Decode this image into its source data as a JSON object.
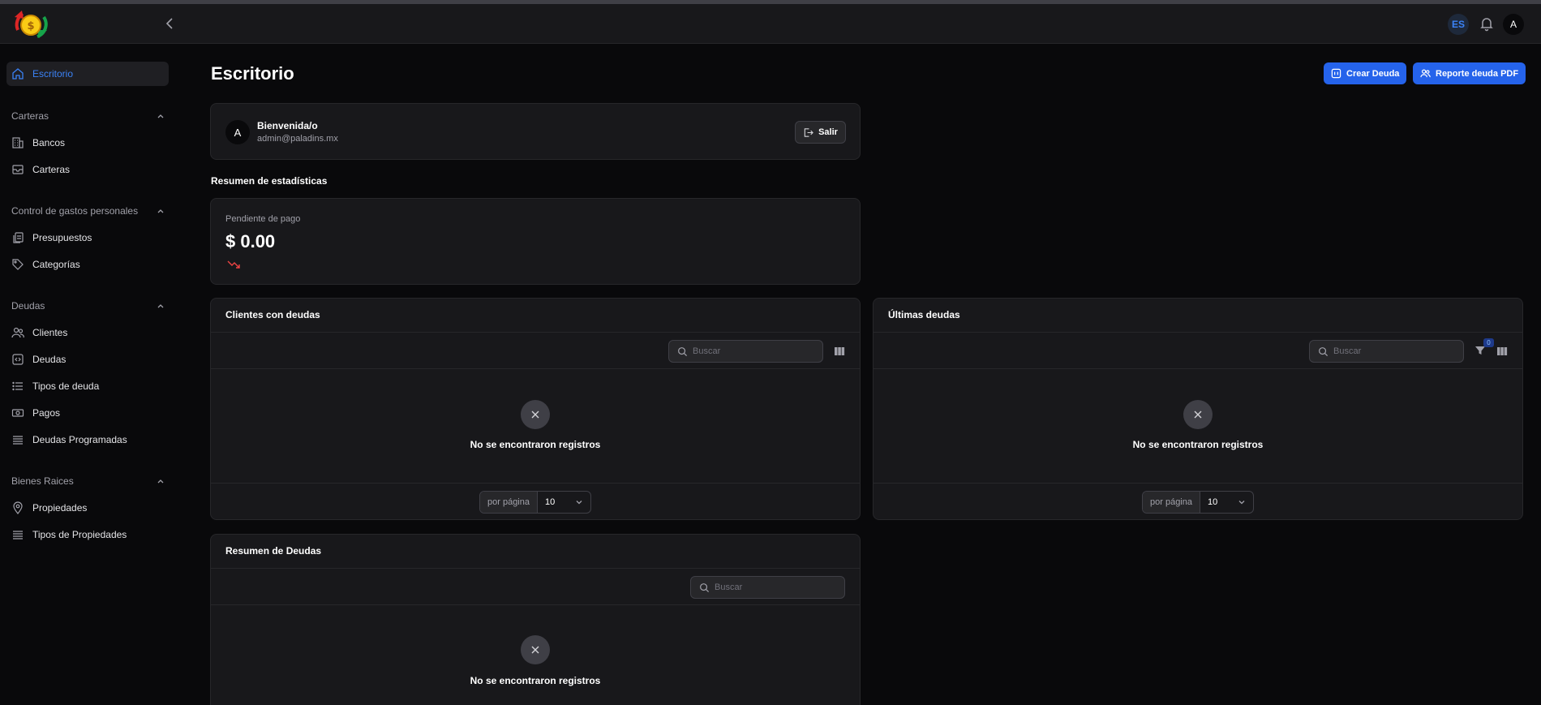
{
  "topbar": {
    "lang_badge": "ES",
    "avatar_initial": "A"
  },
  "sidebar": {
    "active_item": "Escritorio",
    "groups": [
      {
        "label": "Carteras",
        "items": [
          "Bancos",
          "Carteras"
        ]
      },
      {
        "label": "Control de gastos personales",
        "items": [
          "Presupuestos",
          "Categorías"
        ]
      },
      {
        "label": "Deudas",
        "items": [
          "Clientes",
          "Deudas",
          "Tipos de deuda",
          "Pagos",
          "Deudas Programadas"
        ]
      },
      {
        "label": "Bienes Raices",
        "items": [
          "Propiedades",
          "Tipos de Propiedades"
        ]
      }
    ]
  },
  "header": {
    "title": "Escritorio",
    "create_debt_label": "Crear Deuda",
    "report_label": "Reporte deuda PDF"
  },
  "welcome": {
    "avatar_initial": "A",
    "title": "Bienvenida/o",
    "email": "admin@paladins.mx",
    "exit_label": "Salir"
  },
  "stats": {
    "section_title": "Resumen de estadísticas",
    "pending_label": "Pendiente de pago",
    "pending_value": "$ 0.00"
  },
  "tables": {
    "clients": {
      "title": "Clientes con deudas",
      "search_placeholder": "Buscar",
      "empty_text": "No se encontraron registros",
      "per_page_label": "por página",
      "per_page_value": "10"
    },
    "latest": {
      "title": "Últimas deudas",
      "search_placeholder": "Buscar",
      "filter_count": "0",
      "empty_text": "No se encontraron registros",
      "per_page_label": "por página",
      "per_page_value": "10"
    },
    "summary": {
      "title": "Resumen de Deudas",
      "search_placeholder": "Buscar",
      "empty_text": "No se encontraron registros"
    }
  },
  "colors": {
    "accent": "#2563eb",
    "active_text": "#3b82f6",
    "background": "#09090b",
    "card": "#18181b",
    "trend_down": "#ef4444"
  }
}
